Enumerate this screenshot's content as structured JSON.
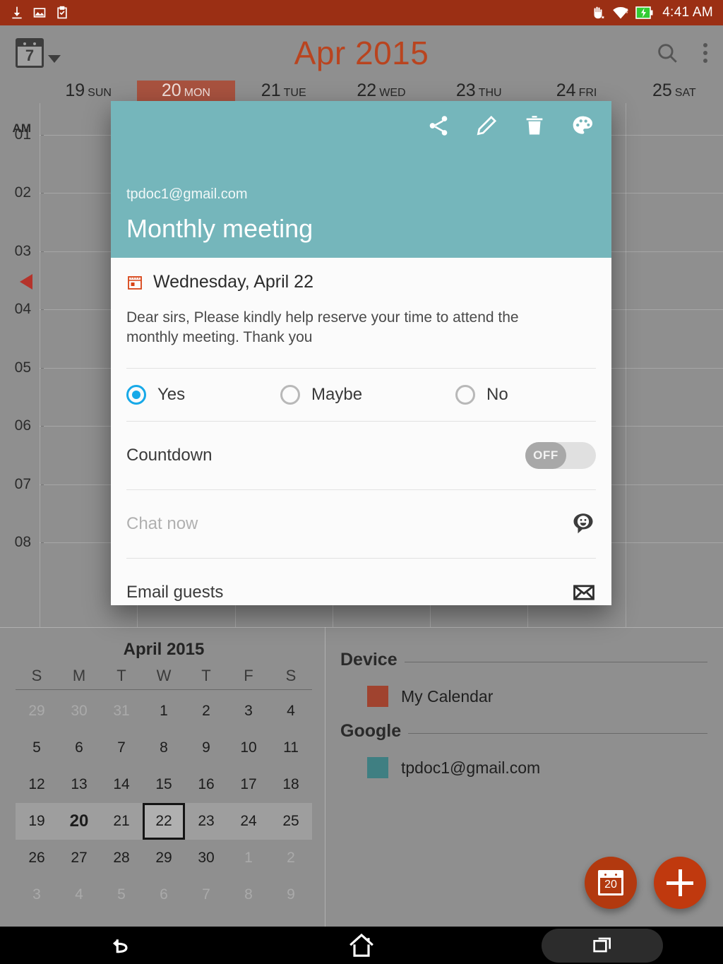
{
  "status_bar": {
    "icons_left": [
      "download-icon",
      "screenshot-icon",
      "clipboard-check-icon"
    ],
    "icons_right": [
      "gesture-hand-icon",
      "wifi-icon",
      "battery-charging-icon"
    ],
    "time": "4:41 AM",
    "background": "#9b2f14"
  },
  "app_bar": {
    "view_picker_label": "7",
    "title": "Apr 2015",
    "title_color": "#b9441f",
    "search_icon": "search-icon",
    "overflow_icon": "more-vertical-icon"
  },
  "day_header": {
    "days": [
      {
        "num": "19",
        "name": "SUN",
        "selected": false
      },
      {
        "num": "20",
        "name": "MON",
        "selected": true
      },
      {
        "num": "21",
        "name": "TUE",
        "selected": false
      },
      {
        "num": "22",
        "name": "WED",
        "selected": false
      },
      {
        "num": "23",
        "name": "THU",
        "selected": false
      },
      {
        "num": "24",
        "name": "FRI",
        "selected": false
      },
      {
        "num": "25",
        "name": "SAT",
        "selected": false
      }
    ],
    "selected_color": "#a8523f"
  },
  "day_grid": {
    "meridiem_label": "AM",
    "hours": [
      "01",
      "02",
      "03",
      "04",
      "05",
      "06",
      "07",
      "08"
    ],
    "now_marker_color": "#b5332b"
  },
  "event_dialog": {
    "account": "tpdoc1@gmail.com",
    "title": "Monthly meeting",
    "header_color": "#75b6bb",
    "actions": [
      {
        "name": "share-icon",
        "label": "Share"
      },
      {
        "name": "edit-pencil-icon",
        "label": "Edit"
      },
      {
        "name": "delete-trash-icon",
        "label": "Delete"
      },
      {
        "name": "color-palette-icon",
        "label": "Color"
      }
    ],
    "date": "Wednesday, April 22",
    "date_icon": "calendar-event-icon",
    "description": "Dear sirs, Please kindly help reserve your time to attend the monthly meeting. Thank you",
    "rsvp": {
      "options": [
        {
          "label": "Yes",
          "selected": true
        },
        {
          "label": "Maybe",
          "selected": false
        },
        {
          "label": "No",
          "selected": false
        }
      ],
      "accent": "#17a9e8"
    },
    "countdown": {
      "label": "Countdown",
      "toggle_state": "OFF"
    },
    "chat": {
      "placeholder": "Chat now",
      "icon": "chat-bubble-smiley-icon"
    },
    "email_guests": {
      "label": "Email guests",
      "icon": "envelope-icon"
    }
  },
  "mini_calendar": {
    "title": "April 2015",
    "dow": [
      "S",
      "M",
      "T",
      "W",
      "T",
      "F",
      "S"
    ],
    "weeks": [
      [
        {
          "d": "29",
          "muted": true
        },
        {
          "d": "30",
          "muted": true
        },
        {
          "d": "31",
          "muted": true
        },
        {
          "d": "1"
        },
        {
          "d": "2"
        },
        {
          "d": "3"
        },
        {
          "d": "4"
        }
      ],
      [
        {
          "d": "5"
        },
        {
          "d": "6"
        },
        {
          "d": "7"
        },
        {
          "d": "8"
        },
        {
          "d": "9"
        },
        {
          "d": "10"
        },
        {
          "d": "11"
        }
      ],
      [
        {
          "d": "12"
        },
        {
          "d": "13"
        },
        {
          "d": "14"
        },
        {
          "d": "15"
        },
        {
          "d": "16"
        },
        {
          "d": "17"
        },
        {
          "d": "18"
        }
      ],
      [
        {
          "d": "19",
          "week": true
        },
        {
          "d": "20",
          "week": true,
          "today": true
        },
        {
          "d": "21",
          "week": true
        },
        {
          "d": "22",
          "week": true,
          "selected": true
        },
        {
          "d": "23",
          "week": true
        },
        {
          "d": "24",
          "week": true
        },
        {
          "d": "25",
          "week": true
        }
      ],
      [
        {
          "d": "26"
        },
        {
          "d": "27"
        },
        {
          "d": "28"
        },
        {
          "d": "29"
        },
        {
          "d": "30"
        },
        {
          "d": "1",
          "muted": true
        },
        {
          "d": "2",
          "muted": true
        }
      ],
      [
        {
          "d": "3",
          "muted": true
        },
        {
          "d": "4",
          "muted": true
        },
        {
          "d": "5",
          "muted": true
        },
        {
          "d": "6",
          "muted": true
        },
        {
          "d": "7",
          "muted": true
        },
        {
          "d": "8",
          "muted": true
        },
        {
          "d": "9",
          "muted": true
        }
      ]
    ]
  },
  "calendar_list": {
    "groups": [
      {
        "header": "Device",
        "items": [
          {
            "label": "My Calendar",
            "color": "#a0432f"
          }
        ]
      },
      {
        "header": "Google",
        "items": [
          {
            "label": "tpdoc1@gmail.com",
            "color": "#3f7f82"
          }
        ]
      }
    ]
  },
  "fabs": {
    "today": {
      "name": "today-fab",
      "day": "20",
      "color": "#b2390f"
    },
    "add": {
      "name": "add-event-fab",
      "color": "#c0390e"
    }
  },
  "nav_bar": {
    "back": "back-icon",
    "home": "home-icon",
    "recents": "recents-icon"
  }
}
